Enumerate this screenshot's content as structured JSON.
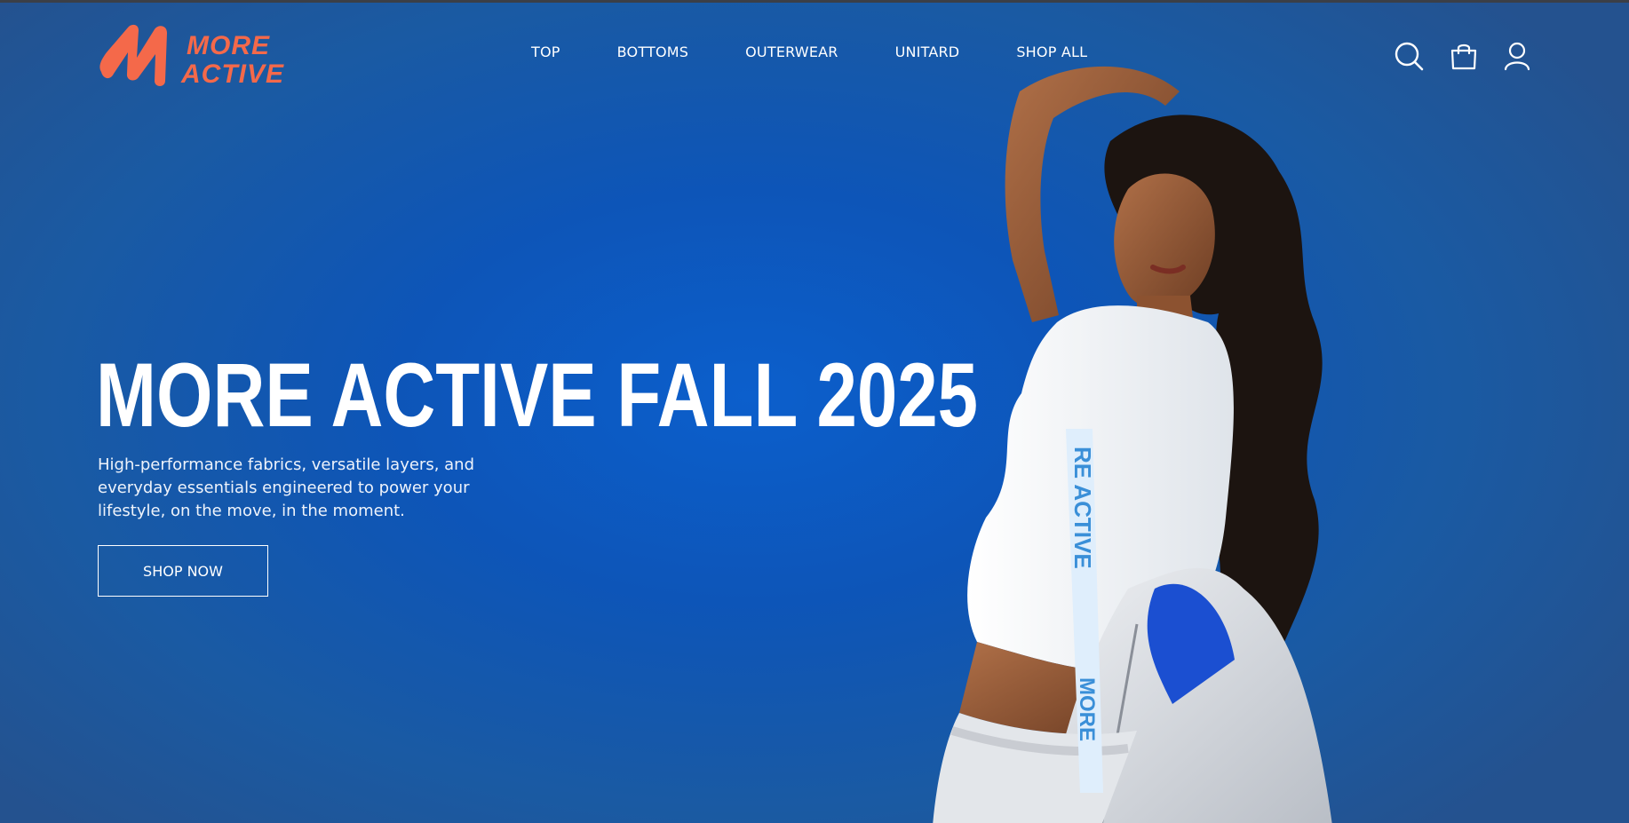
{
  "brand": {
    "name_line1": "MORE",
    "name_line2": "ACTIVE",
    "logo_color": "#f4694a"
  },
  "nav": {
    "items": [
      {
        "label": "TOP"
      },
      {
        "label": "BOTTOMS"
      },
      {
        "label": "OUTERWEAR"
      },
      {
        "label": "UNITARD"
      },
      {
        "label": "SHOP ALL"
      }
    ]
  },
  "header_icons": [
    "search-icon",
    "shopping-bag-icon",
    "user-icon"
  ],
  "hero": {
    "title": "MORE ACTIVE FALL 2025",
    "subtitle": "High-performance fabrics, versatile layers, and everyday essentials engineered to power your lifestyle, on the move, in the moment.",
    "cta_label": "SHOP NOW",
    "strap_text_1": "RE ACTIVE",
    "strap_text_2": "MORE"
  },
  "colors": {
    "background": "#0d55b8",
    "accent": "#f4694a",
    "text": "#ffffff"
  }
}
